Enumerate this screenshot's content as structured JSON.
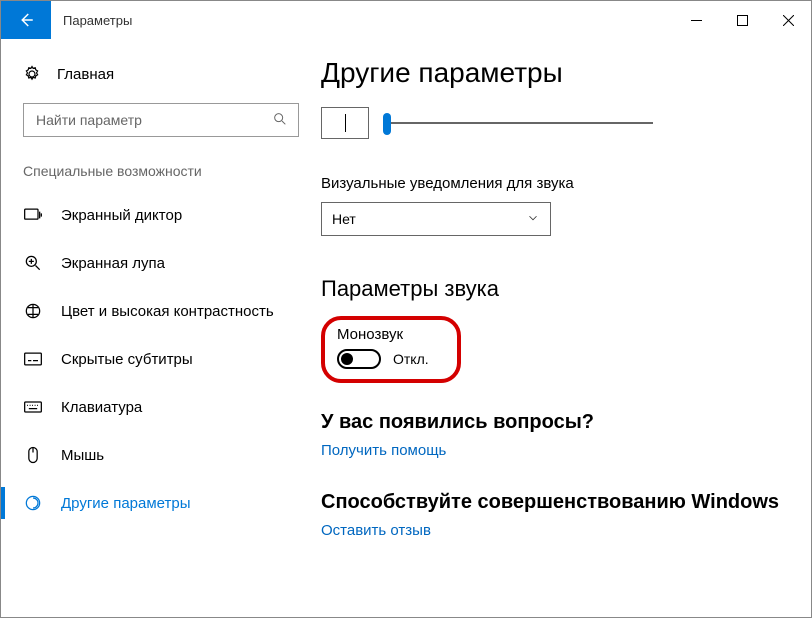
{
  "window": {
    "title": "Параметры"
  },
  "sidebar": {
    "home": "Главная",
    "search_placeholder": "Найти параметр",
    "category": "Специальные возможности",
    "items": [
      {
        "label": "Экранный диктор"
      },
      {
        "label": "Экранная лупа"
      },
      {
        "label": "Цвет и высокая контрастность"
      },
      {
        "label": "Скрытые субтитры"
      },
      {
        "label": "Клавиатура"
      },
      {
        "label": "Мышь"
      },
      {
        "label": "Другие параметры"
      }
    ]
  },
  "content": {
    "page_title": "Другие параметры",
    "visual_notif_label": "Визуальные уведомления для звука",
    "visual_notif_value": "Нет",
    "sound_section": "Параметры звука",
    "mono_label": "Монозвук",
    "toggle_state": "Откл.",
    "help_title": "У вас появились вопросы?",
    "help_link": "Получить помощь",
    "feedback_title": "Способствуйте совершенствованию Windows",
    "feedback_link": "Оставить отзыв"
  }
}
